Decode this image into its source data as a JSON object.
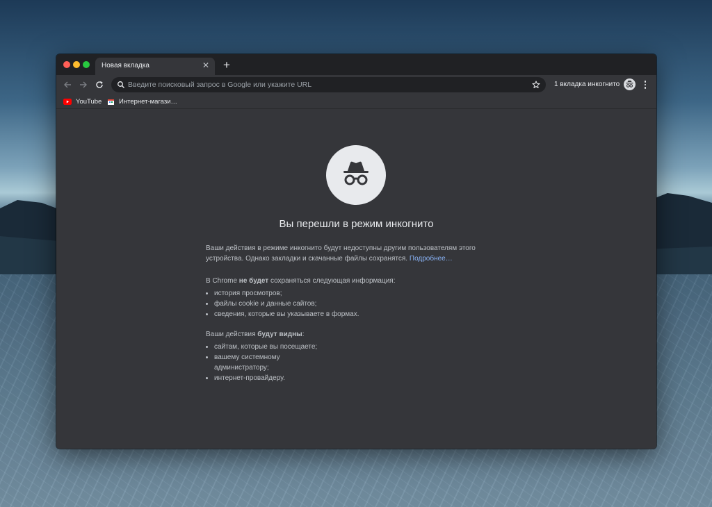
{
  "colors": {
    "accent_link": "#8ab4f8",
    "tabstrip_bg": "#202124",
    "page_bg": "#35363a",
    "text_primary": "#e8eaed",
    "text_secondary": "#bdc1c6",
    "close_red": "#ff5f57",
    "minimize_yellow": "#febc2e",
    "maximize_green": "#28c840"
  },
  "tab": {
    "title": "Новая вкладка",
    "close_icon": "close-icon"
  },
  "toolbar": {
    "back_icon": "arrow-left-icon",
    "forward_icon": "arrow-right-icon",
    "reload_icon": "reload-icon",
    "omnibox_placeholder": "Введите поисковый запрос в Google или укажите URL",
    "bookmark_icon": "star-icon",
    "incognito_label": "1 вкладка инкогнито",
    "menu_icon": "kebab-menu-icon"
  },
  "bookmarks": [
    {
      "label": "YouTube",
      "icon": "youtube-icon"
    },
    {
      "label": "Интернет-магази…",
      "icon": "store-icon"
    }
  ],
  "page": {
    "heading": "Вы перешли в режим инкогнито",
    "intro_text": "Ваши действия в режиме инкогнито будут недоступны другим пользователям этого устройства. Однако закладки и скачанные файлы сохранятся.",
    "learn_more": "Подробнее…",
    "not_saved_prefix": "В Chrome ",
    "not_saved_bold": "не будет",
    "not_saved_suffix": " сохраняться следующая информация:",
    "not_saved_items": [
      "история просмотров;",
      "файлы cookie и данные сайтов;",
      "сведения, которые вы указываете в формах."
    ],
    "visible_prefix": "Ваши действия ",
    "visible_bold": "будут видны",
    "visible_suffix": ":",
    "visible_items": [
      "сайтам, которые вы посещаете;",
      "вашему системному администратору;",
      "интернет-провайдеру."
    ]
  }
}
